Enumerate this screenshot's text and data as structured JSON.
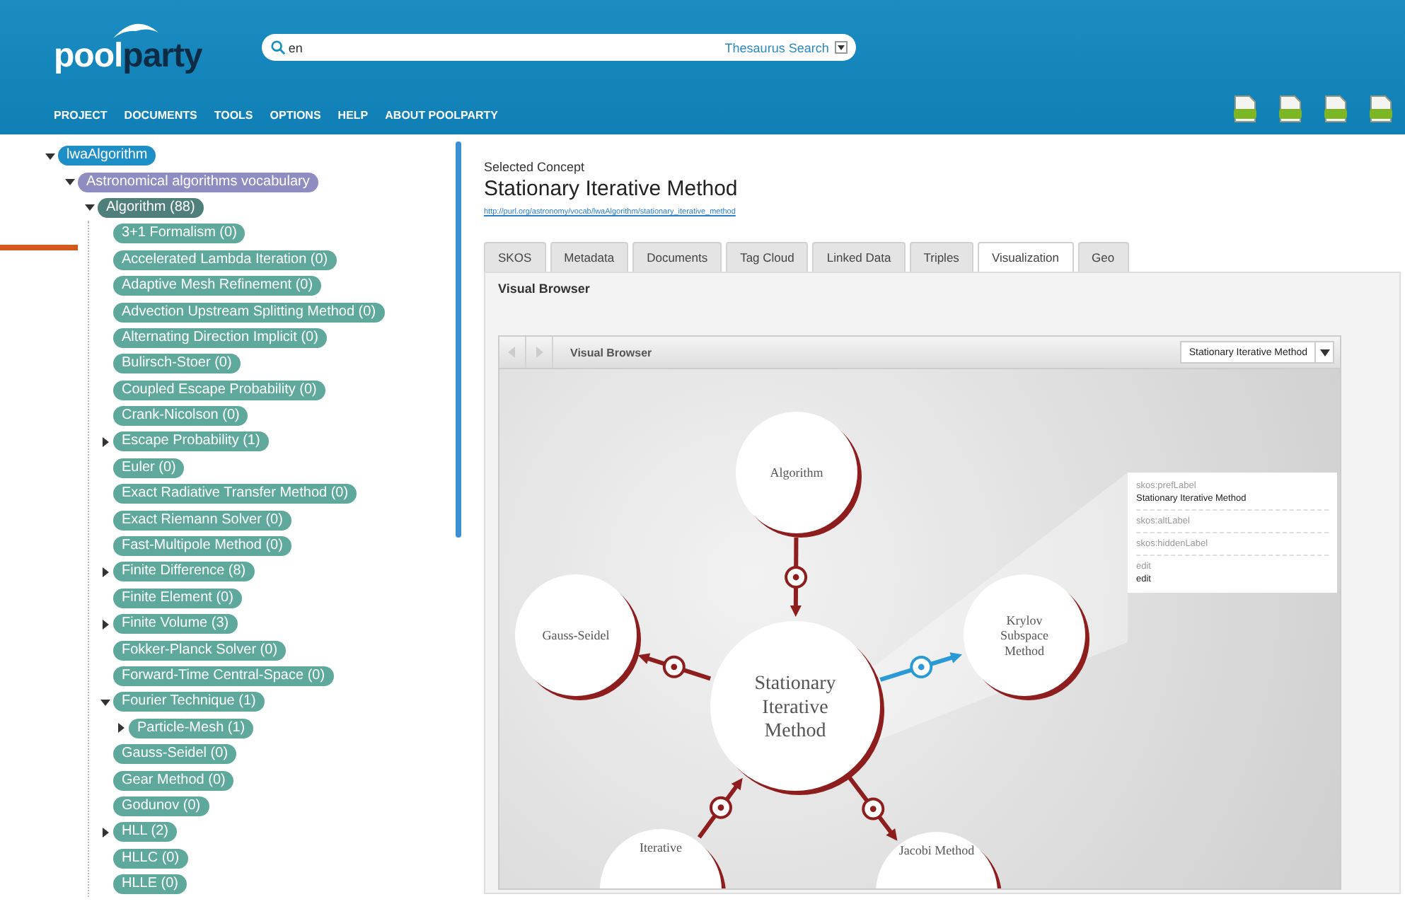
{
  "logo": {
    "part_1": "pool",
    "part_2": "party"
  },
  "search": {
    "value": "en",
    "scope": "Thesaurus Search"
  },
  "menu": [
    "PROJECT",
    "DOCUMENTS",
    "TOOLS",
    "OPTIONS",
    "HELP",
    "ABOUT POOLPARTY"
  ],
  "tree": [
    {
      "label": "lwaAlgorithm",
      "expanded": true,
      "children": [
        {
          "label": "Astronomical algorithms vocabulary",
          "expanded": true,
          "children": [
            {
              "label": "Algorithm (88)",
              "expanded": true,
              "children": [
                {
                  "label": "3+1 Formalism (0)"
                },
                {
                  "label": "Accelerated Lambda Iteration (0)"
                },
                {
                  "label": "Adaptive Mesh Refinement (0)"
                },
                {
                  "label": "Advection Upstream Splitting Method (0)"
                },
                {
                  "label": "Alternating Direction Implicit (0)"
                },
                {
                  "label": "Bulirsch-Stoer (0)"
                },
                {
                  "label": "Coupled Escape Probability (0)"
                },
                {
                  "label": "Crank-Nicolson (0)"
                },
                {
                  "label": "Escape Probability (1)",
                  "expanded": false
                },
                {
                  "label": "Euler (0)"
                },
                {
                  "label": "Exact Radiative Transfer Method (0)"
                },
                {
                  "label": "Exact Riemann Solver (0)"
                },
                {
                  "label": "Fast-Multipole Method (0)"
                },
                {
                  "label": "Finite Difference (8)",
                  "expanded": false
                },
                {
                  "label": "Finite Element (0)"
                },
                {
                  "label": "Finite Volume (3)",
                  "expanded": false
                },
                {
                  "label": "Fokker-Planck Solver (0)"
                },
                {
                  "label": "Forward-Time Central-Space (0)"
                },
                {
                  "label": "Fourier Technique (1)",
                  "expanded": true,
                  "children": [
                    {
                      "label": "Particle-Mesh (1)",
                      "expanded": false
                    }
                  ]
                },
                {
                  "label": "Gauss-Seidel (0)"
                },
                {
                  "label": "Gear Method (0)"
                },
                {
                  "label": "Godunov (0)"
                },
                {
                  "label": "HLL (2)",
                  "expanded": false
                },
                {
                  "label": "HLLC (0)"
                },
                {
                  "label": "HLLE (0)"
                }
              ]
            }
          ]
        }
      ]
    }
  ],
  "concept": {
    "caption": "Selected Concept",
    "title": "Stationary Iterative Method",
    "uri": "http://purl.org/astronomy/vocab/lwaAlgorithm/stationary_iterative_method"
  },
  "tabs": [
    {
      "label": "SKOS",
      "selected": false
    },
    {
      "label": "Metadata",
      "selected": false
    },
    {
      "label": "Documents",
      "selected": false
    },
    {
      "label": "Tag Cloud",
      "selected": false
    },
    {
      "label": "Linked Data",
      "selected": false
    },
    {
      "label": "Triples",
      "selected": false
    },
    {
      "label": "Visualization",
      "selected": true
    },
    {
      "label": "Geo",
      "selected": false
    }
  ],
  "panel_title": "Visual Browser",
  "visual_browser": {
    "title": "Visual Browser",
    "concept": "Stationary Iterative Method",
    "nodes": [
      {
        "label": "Algorithm",
        "kind": "related"
      },
      {
        "label": "Gauss-Seidel",
        "kind": "related"
      },
      {
        "label": "Krylov Subspace Method",
        "kind": "related"
      },
      {
        "label": "Stationary Iterative Method",
        "kind": "center"
      },
      {
        "label": "Iterative",
        "kind": "related"
      },
      {
        "label": "Jacobi Method",
        "kind": "related"
      }
    ],
    "edges": [
      {
        "selected": false
      },
      {
        "selected": false
      },
      {
        "selected": true
      },
      {
        "selected": false
      },
      {
        "selected": false
      }
    ],
    "details": [
      {
        "label": "skos:prefLabel",
        "value": "Stationary Iterative Method"
      },
      {
        "label": "skos:altLabel"
      },
      {
        "label": "skos:hiddenLabel"
      },
      {
        "label": "edit",
        "value": "edit"
      }
    ]
  }
}
